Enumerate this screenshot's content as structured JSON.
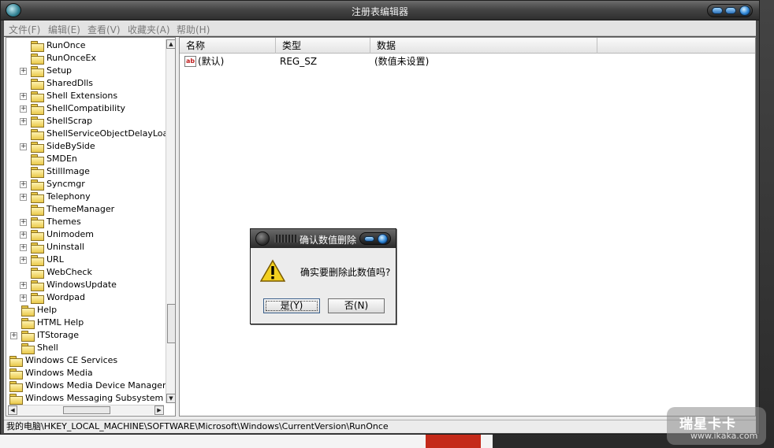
{
  "window": {
    "title": "注册表编辑器"
  },
  "menu": [
    {
      "label": "文件(F)"
    },
    {
      "label": "编辑(E)"
    },
    {
      "label": "查看(V)"
    },
    {
      "label": "收藏夹(A)"
    },
    {
      "label": "帮助(H)"
    }
  ],
  "tree": {
    "items": [
      {
        "label": "RunOnce",
        "expandable": false
      },
      {
        "label": "RunOnceEx",
        "expandable": false
      },
      {
        "label": "Setup",
        "expandable": true
      },
      {
        "label": "SharedDlls",
        "expandable": false
      },
      {
        "label": "Shell Extensions",
        "expandable": true
      },
      {
        "label": "ShellCompatibility",
        "expandable": true
      },
      {
        "label": "ShellScrap",
        "expandable": true
      },
      {
        "label": "ShellServiceObjectDelayLoad",
        "expandable": false
      },
      {
        "label": "SideBySide",
        "expandable": true
      },
      {
        "label": "SMDEn",
        "expandable": false
      },
      {
        "label": "StillImage",
        "expandable": false
      },
      {
        "label": "Syncmgr",
        "expandable": true
      },
      {
        "label": "Telephony",
        "expandable": true
      },
      {
        "label": "ThemeManager",
        "expandable": false
      },
      {
        "label": "Themes",
        "expandable": true
      },
      {
        "label": "Unimodem",
        "expandable": true
      },
      {
        "label": "Uninstall",
        "expandable": true
      },
      {
        "label": "URL",
        "expandable": true
      },
      {
        "label": "WebCheck",
        "expandable": false
      },
      {
        "label": "WindowsUpdate",
        "expandable": true
      },
      {
        "label": "Wordpad",
        "expandable": true
      },
      {
        "label": "Help",
        "expandable": false
      },
      {
        "label": "HTML Help",
        "expandable": false
      },
      {
        "label": "ITStorage",
        "expandable": true
      },
      {
        "label": "Shell",
        "expandable": false
      },
      {
        "label": "Windows CE Services",
        "expandable": false
      },
      {
        "label": "Windows Media",
        "expandable": false
      },
      {
        "label": "Windows Media Device Manager",
        "expandable": false
      },
      {
        "label": "Windows Messaging Subsystem",
        "expandable": false
      }
    ]
  },
  "list": {
    "columns": [
      "名称",
      "类型",
      "数据"
    ],
    "rows": [
      {
        "name": "(默认)",
        "type": "REG_SZ",
        "data": "(数值未设置)"
      }
    ]
  },
  "dialog": {
    "title": "确认数值删除",
    "message": "确实要删除此数值吗?",
    "yes_label": "是(Y)",
    "no_label": "否(N)"
  },
  "statusbar": {
    "path": "我的电脑\\HKEY_LOCAL_MACHINE\\SOFTWARE\\Microsoft\\Windows\\CurrentVersion\\RunOnce"
  },
  "watermark": {
    "logo": "瑞星卡卡",
    "url": "www.ikaka.com"
  },
  "colors": {
    "title_bg": "#2e2e2e",
    "accent_blue": "#2f86d6",
    "folder": "#e9c94a"
  }
}
